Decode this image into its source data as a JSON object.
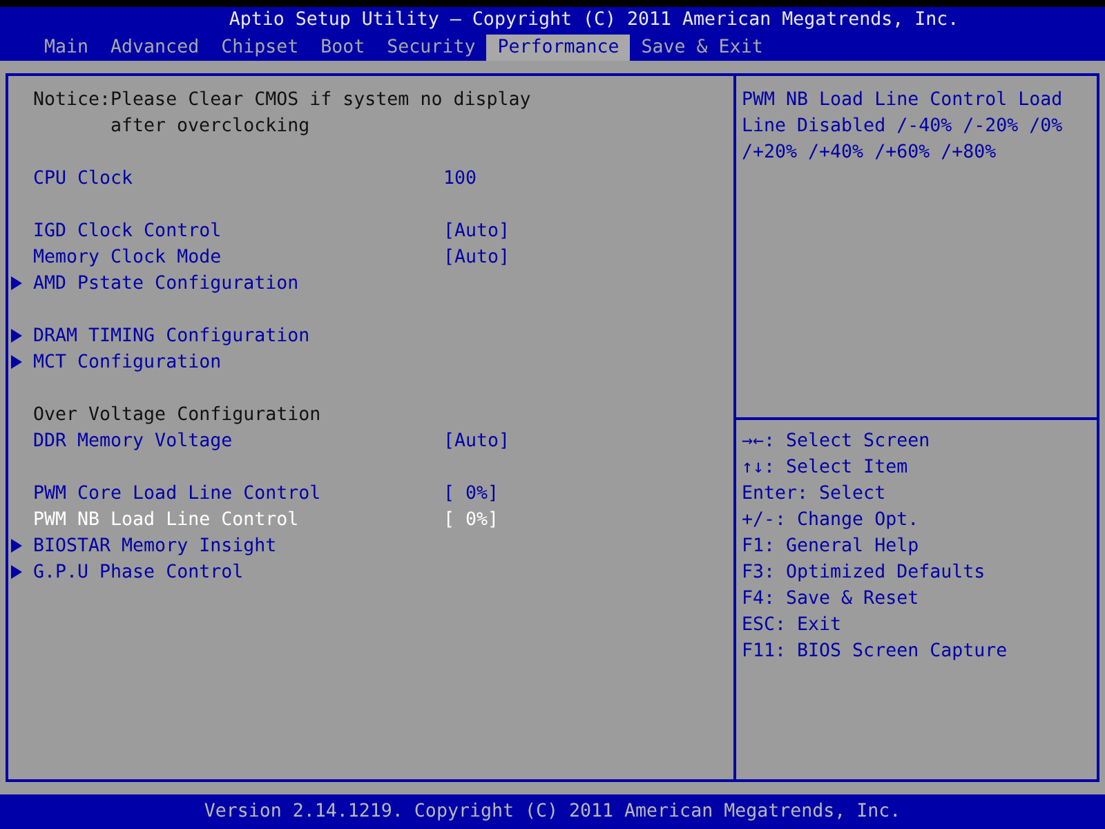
{
  "window": {
    "title": "Aptio Setup Utility – Copyright (C) 2011 American Megatrends, Inc."
  },
  "tabs": [
    {
      "label": "Main",
      "selected": false
    },
    {
      "label": "Advanced",
      "selected": false
    },
    {
      "label": "Chipset",
      "selected": false
    },
    {
      "label": "Boot",
      "selected": false
    },
    {
      "label": "Security",
      "selected": false
    },
    {
      "label": "Performance",
      "selected": true
    },
    {
      "label": "Save & Exit",
      "selected": false
    }
  ],
  "groups": [
    [
      {
        "kind": "notice",
        "lines": [
          "Notice:Please Clear CMOS if system no display",
          "after overclocking"
        ]
      }
    ],
    [
      {
        "kind": "setting",
        "label": "CPU Clock",
        "value": "100",
        "selected": false
      }
    ],
    [
      {
        "kind": "setting",
        "label": "IGD Clock Control",
        "value": "[Auto]",
        "selected": false
      },
      {
        "kind": "setting",
        "label": "Memory Clock Mode",
        "value": "[Auto]",
        "selected": false
      },
      {
        "kind": "submenu",
        "label": "AMD Pstate Configuration",
        "selected": false
      }
    ],
    [
      {
        "kind": "submenu",
        "label": "DRAM TIMING Configuration",
        "selected": false
      },
      {
        "kind": "submenu",
        "label": "MCT Configuration",
        "selected": false
      }
    ],
    [
      {
        "kind": "heading",
        "label": "Over Voltage Configuration"
      },
      {
        "kind": "setting",
        "label": "DDR Memory Voltage",
        "value": "[Auto]",
        "selected": false
      }
    ],
    [
      {
        "kind": "setting",
        "label": "PWM Core Load Line Control",
        "value": "[ 0%]",
        "selected": false
      },
      {
        "kind": "setting",
        "label": "PWM NB Load Line Control",
        "value": "[ 0%]",
        "selected": true
      },
      {
        "kind": "submenu",
        "label": "BIOSTAR Memory Insight",
        "selected": false
      },
      {
        "kind": "submenu",
        "label": "G.P.U Phase Control",
        "selected": false
      }
    ]
  ],
  "help_text": "PWM NB Load Line Control Load Line Disabled /-40% /-20% /0% /+20% /+40% /+60% /+80%",
  "key_help": [
    "→←: Select Screen",
    "↑↓: Select Item",
    "Enter: Select",
    "+/-: Change Opt.",
    "F1: General Help",
    "F3: Optimized Defaults",
    "F4: Save & Reset",
    "ESC: Exit",
    "F11: BIOS Screen Capture"
  ],
  "status_bar": "Version 2.14.1219. Copyright (C) 2011 American Megatrends, Inc."
}
